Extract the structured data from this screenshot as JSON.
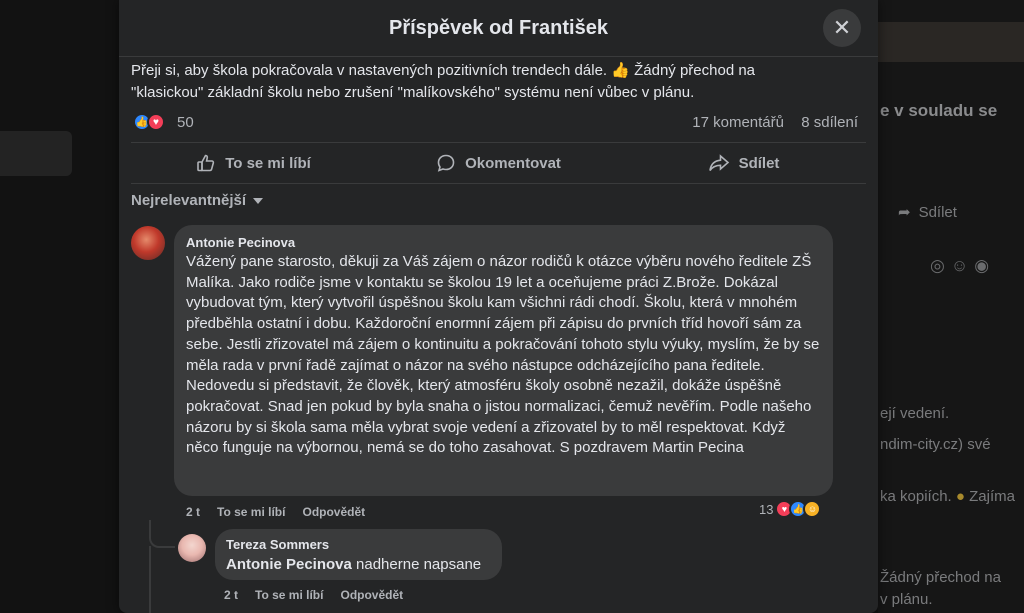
{
  "background": {
    "right_texts": [
      "e v souladu se",
      "Sdílet",
      "ejí vedení.",
      "ndim-city.cz) své",
      "ka kopiích.",
      "Zajíma",
      "Žádný přechod na",
      "v plánu."
    ]
  },
  "modal": {
    "title": "Příspěvek od František",
    "post_text": "Přeji si,  aby škola pokračovala v nastavených pozitivních trendech dále. 👍 Žádný přechod na \"klasickou\" základní školu nebo zrušení \"malíkovského\" systému není vůbec v plánu.",
    "reaction_count": "50",
    "comments_count": "17 komentářů",
    "shares_count": "8 sdílení",
    "actions": {
      "like": "To se mi líbí",
      "comment": "Okomentovat",
      "share": "Sdílet"
    },
    "sort_label": "Nejrelevantnější"
  },
  "comments": [
    {
      "author": "Antonie Pecinova",
      "text": "Vážený pane starosto, děkuji za Váš zájem o názor rodičů k otázce výběru nového ředitele ZŠ Malíka. Jako rodiče jsme v kontaktu se školou 19 let a oceňujeme práci Z.Brože. Dokázal vybudovat tým, který vytvořil úspěšnou školu kam všichni rádi chodí. Školu, která v mnohém předběhla ostatní i dobu. Každoroční enormní zájem při zápisu do prvních tříd hovoří sám za sebe. Jestli zřizovatel má zájem o kontinuitu a pokračování tohoto stylu výuky, myslím, že by se měla rada v první řadě zajímat o názor na svého nástupce odcházejícího pana ředitele. Nedovedu si představit, že člověk, který atmosféru školy osobně nezažil, dokáže úspěšně pokračovat. Snad jen pokud by byla snaha o jistou normalizaci, čemuž nevěřím. Podle našeho názoru by si škola sama měla vybrat svoje vedení a zřizovatel by to měl respektovat. Když něco funguje na výbornou, nemá se do toho zasahovat. S pozdravem Martin Pecina",
      "time": "2 t",
      "like_label": "To se mi líbí",
      "reply_label": "Odpovědět",
      "reaction_count": "13"
    },
    {
      "author": "Tereza Sommers",
      "mention": "Antonie Pecinova",
      "text": "nadherne napsane",
      "time": "2 t",
      "like_label": "To se mi líbí",
      "reply_label": "Odpovědět"
    }
  ]
}
